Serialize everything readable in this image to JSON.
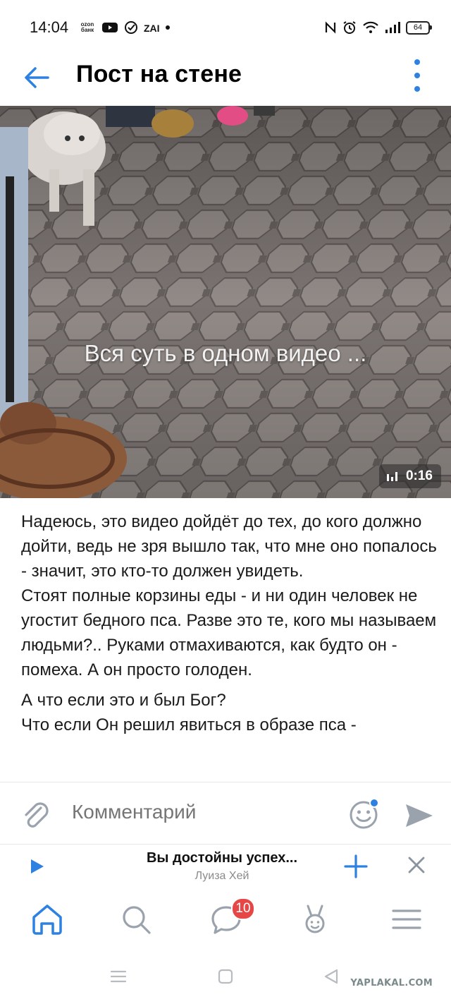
{
  "status_bar": {
    "time": "14:04",
    "left_icons": [
      "ozon-bank-icon",
      "youtube-icon",
      "check-circle-icon",
      "ai-icon",
      "dot-icon"
    ],
    "ozon_label": "ozon банк",
    "battery": "64"
  },
  "header": {
    "title": "Пост на стене",
    "back_icon": "arrow-left-icon",
    "menu_icon": "more-vertical-icon"
  },
  "video": {
    "caption": "Вся суть в одном видео ...",
    "duration": "0:16"
  },
  "post": {
    "paragraph1": "Надеюсь, это видео дойдёт до тех, до кого должно дойти, ведь не зря вышло так, что мне оно попалось - значит, это кто-то должен увидеть.",
    "paragraph2": "Стоят полные корзины еды - и ни один человек не угостит бедного пса. Разве это те, кого мы называем людьми?.. Руками отмахиваются, как будто он - помеха. А он просто голоден.",
    "paragraph3": "А что если это и был Бог?",
    "paragraph4": "Что если Он решил явиться в образе пса -"
  },
  "comment_bar": {
    "placeholder": "Комментарий"
  },
  "player": {
    "title": "Вы достойны успех...",
    "artist": "Луиза Хей"
  },
  "tabbar": {
    "messages_badge": "10",
    "tabs": [
      "home-icon",
      "search-icon",
      "messages-icon",
      "clips-icon",
      "menu-icon"
    ]
  },
  "watermark": "YAPLAKAL.COM",
  "colors": {
    "accent": "#2d81e0",
    "badge": "#e64646",
    "muted_text": "#8a8a8a"
  }
}
